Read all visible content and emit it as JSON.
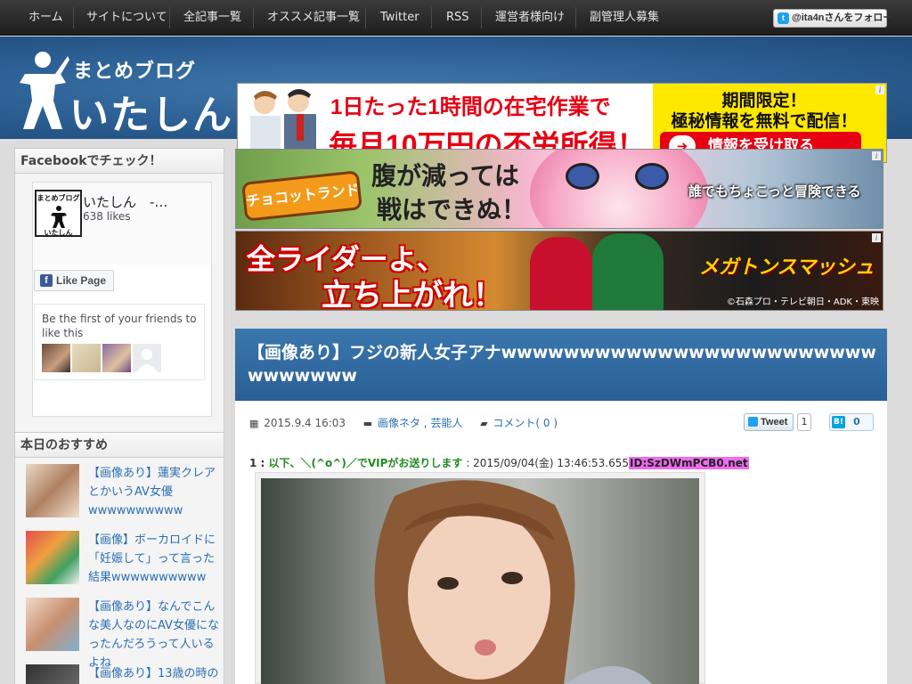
{
  "nav": {
    "items": [
      "ホーム",
      "サイトについて",
      "全記事一覧",
      "オススメ記事一覧",
      "Twitter",
      "RSS",
      "運営者様向け",
      "副管理人募集"
    ],
    "follow_label": "@ita4nさんをフォロー"
  },
  "site": {
    "logo_small": "まとめブログ",
    "logo_big": "いたしん"
  },
  "header_ad": {
    "line1": "1日たった1時間の在宅作業で",
    "line2": "毎月10万円の不労所得！",
    "right1": "期間限定！",
    "right2": "極秘情報を無料で配信！",
    "cta": "情報を受け取る",
    "info": "i"
  },
  "sidebar": {
    "facebook": {
      "title": "Facebookでチェック！",
      "thumb_small": "まとめブログ",
      "thumb_big": "いたしん",
      "page_name": "いたしん　-…",
      "likes": "638 likes",
      "like_button": "Like Page",
      "friends_text": "Be the first of your friends to like this"
    },
    "recommend": {
      "title": "本日のおすすめ",
      "items": [
        {
          "title": "【画像あり】蓮実クレアとかいうAV女優wwwwwwwwww"
        },
        {
          "title": "【画像】ボーカロイドに「妊娠して」って言った結果wwwwwwwwww"
        },
        {
          "title": "【画像あり】なんでこんな美人なのにAV女優になったんだろうって人いるよね"
        },
        {
          "title": "【画像あり】13歳の時の"
        }
      ]
    }
  },
  "banners": {
    "choco": {
      "logo": "チョコットランド",
      "line1": "腹が減っては",
      "line2": "戦はできぬ！",
      "tag": "誰でもちょこっと冒険できる",
      "info": "i"
    },
    "rider": {
      "line1": "全ライダーよ、",
      "line2": "立ち上がれ！",
      "logo": "メガトンスマッシュ",
      "copyright": "©石森プロ・テレビ朝日・ADK・東映",
      "info": "i"
    }
  },
  "article": {
    "title": "【画像あり】フジの新人女子アナwwwwwwwwwwwwwwwwwwwwwwwwwwwwwww",
    "date": "2015.9.4 16:03",
    "category1": "画像ネタ",
    "category_sep": " , ",
    "category2": "芸能人",
    "comments": "コメント( 0 )",
    "tweet_label": "Tweet",
    "tweet_count": "1",
    "hatena_label": "B!",
    "hatena_count": "0",
    "post": {
      "number": "1 : ",
      "name": "以下、＼(^o^)／でVIPがお送りします",
      "datetime": " : 2015/09/04(金) 13:46:53.655",
      "id": "ID:SzDWmPCB0.net"
    }
  },
  "colors": {
    "nav_bg": "#262626",
    "header_blue": "#2c5f93",
    "link": "#2a6fb3",
    "ad_red": "#e60012",
    "ad_yellow": "#ffe800",
    "post_name": "#228b22",
    "id_highlight": "#ef6bef"
  }
}
